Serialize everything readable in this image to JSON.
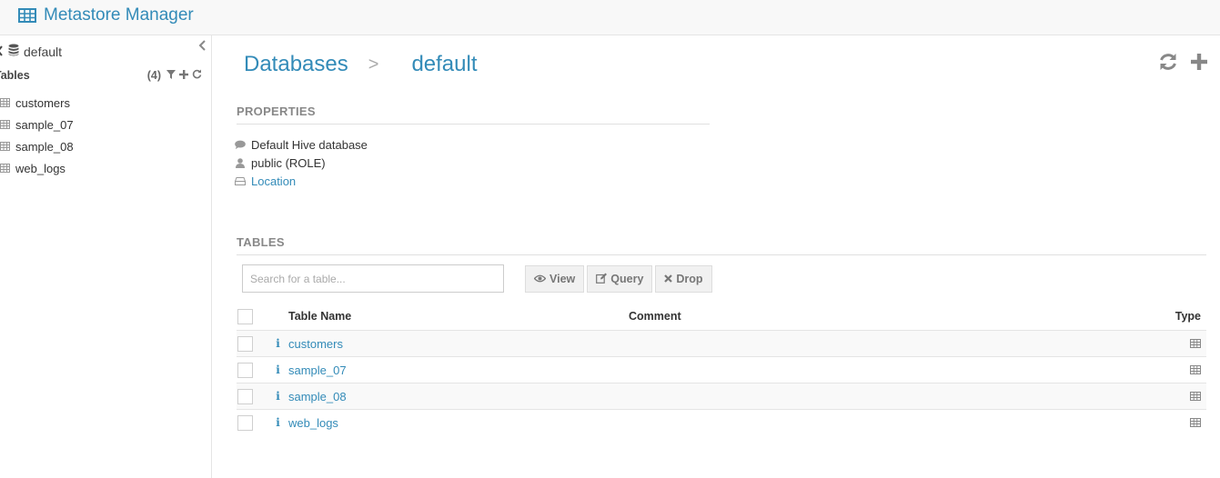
{
  "app": {
    "title": "Metastore Manager"
  },
  "sidebar": {
    "database": "default",
    "tables_label": "Tables",
    "tables_count": "(4)",
    "items": [
      {
        "label": "customers"
      },
      {
        "label": "sample_07"
      },
      {
        "label": "sample_08"
      },
      {
        "label": "web_logs"
      }
    ]
  },
  "breadcrumb": {
    "root": "Databases",
    "separator": ">",
    "current": "default"
  },
  "properties": {
    "heading": "PROPERTIES",
    "description": "Default Hive database",
    "owner": "public (ROLE)",
    "location_label": "Location"
  },
  "tables_section": {
    "heading": "TABLES",
    "search_placeholder": "Search for a table...",
    "buttons": {
      "view": "View",
      "query": "Query",
      "drop": "Drop"
    },
    "columns": {
      "name": "Table Name",
      "comment": "Comment",
      "type": "Type"
    },
    "info_glyph": "i",
    "rows": [
      {
        "name": "customers",
        "comment": ""
      },
      {
        "name": "sample_07",
        "comment": ""
      },
      {
        "name": "sample_08",
        "comment": ""
      },
      {
        "name": "web_logs",
        "comment": ""
      }
    ]
  },
  "colors": {
    "accent": "#338bb8",
    "muted": "#888888",
    "border": "#e5e5e5"
  },
  "icons": [
    "table-icon",
    "database-icon",
    "chevron-left-icon",
    "filter-icon",
    "plus-icon",
    "refresh-icon",
    "comment-icon",
    "user-icon",
    "hdd-icon",
    "eye-icon",
    "edit-icon",
    "times-icon",
    "info-icon"
  ]
}
